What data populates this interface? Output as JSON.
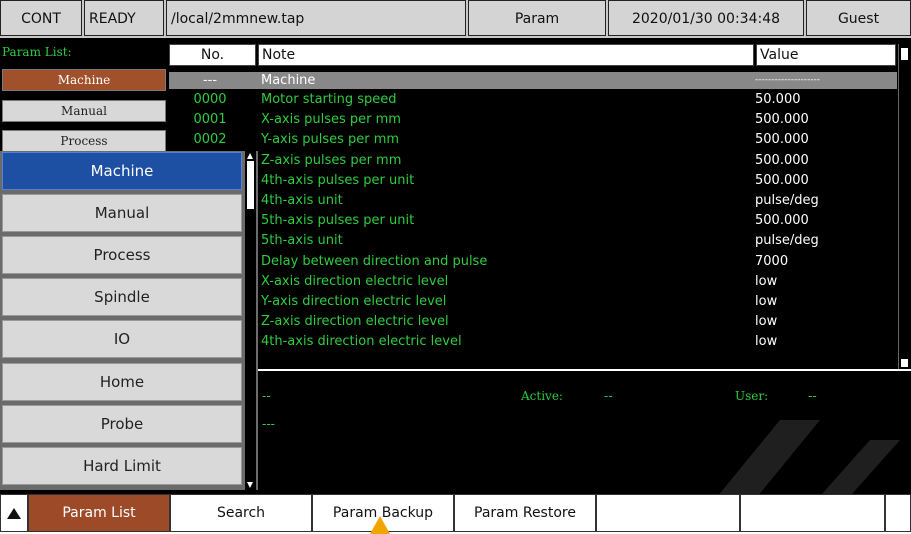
{
  "topbar": {
    "mode": "CONT",
    "state": "READY",
    "file": "/local/2mmnew.tap",
    "screen": "Param",
    "datetime": "2020/01/30 00:34:48",
    "user": "Guest"
  },
  "sidebar": {
    "title": "Param List:",
    "items": [
      {
        "label": "Machine",
        "active": true
      },
      {
        "label": "Manual",
        "active": false
      },
      {
        "label": "Process",
        "active": false
      }
    ]
  },
  "table": {
    "headers": {
      "no": "No.",
      "note": "Note",
      "value": "Value"
    },
    "group_no": "---",
    "group_label": "Machine",
    "group_value": "--------------------",
    "rows": [
      {
        "no": "0000",
        "note": "Motor starting speed",
        "value": "50.000"
      },
      {
        "no": "0001",
        "note": "X-axis pulses per mm",
        "value": "500.000"
      },
      {
        "no": "0002",
        "note": "Y-axis pulses per mm",
        "value": "500.000"
      },
      {
        "no": "",
        "note": "Z-axis pulses per mm",
        "value": "500.000"
      },
      {
        "no": "",
        "note": "4th-axis pulses per unit",
        "value": "500.000"
      },
      {
        "no": "",
        "note": "4th-axis unit",
        "value": "pulse/deg"
      },
      {
        "no": "",
        "note": "5th-axis pulses per unit",
        "value": "500.000"
      },
      {
        "no": "",
        "note": "5th-axis unit",
        "value": "pulse/deg"
      },
      {
        "no": "",
        "note": "Delay between direction and pulse",
        "value": "7000"
      },
      {
        "no": "",
        "note": "X-axis direction electric level",
        "value": "low"
      },
      {
        "no": "",
        "note": "Y-axis direction electric level",
        "value": "low"
      },
      {
        "no": "",
        "note": "Z-axis direction electric level",
        "value": "low"
      },
      {
        "no": "",
        "note": "4th-axis direction electric level",
        "value": "low"
      }
    ]
  },
  "status": {
    "line1": "--",
    "active_label": "Active:",
    "active_value": "--",
    "user_label": "User:",
    "user_value": "--",
    "line2": "---"
  },
  "dropdown": {
    "items": [
      "Machine",
      "Manual",
      "Process",
      "Spindle",
      "IO",
      "Home",
      "Probe",
      "Hard Limit"
    ],
    "selected": "Machine"
  },
  "bottombar": {
    "buttons": [
      "Param List",
      "Search",
      "Param Backup",
      "Param Restore",
      "",
      "",
      "",
      ""
    ]
  },
  "colors": {
    "accent": "#9c4a28",
    "selected": "#1d4fa3",
    "text_green": "#2ecc40"
  }
}
